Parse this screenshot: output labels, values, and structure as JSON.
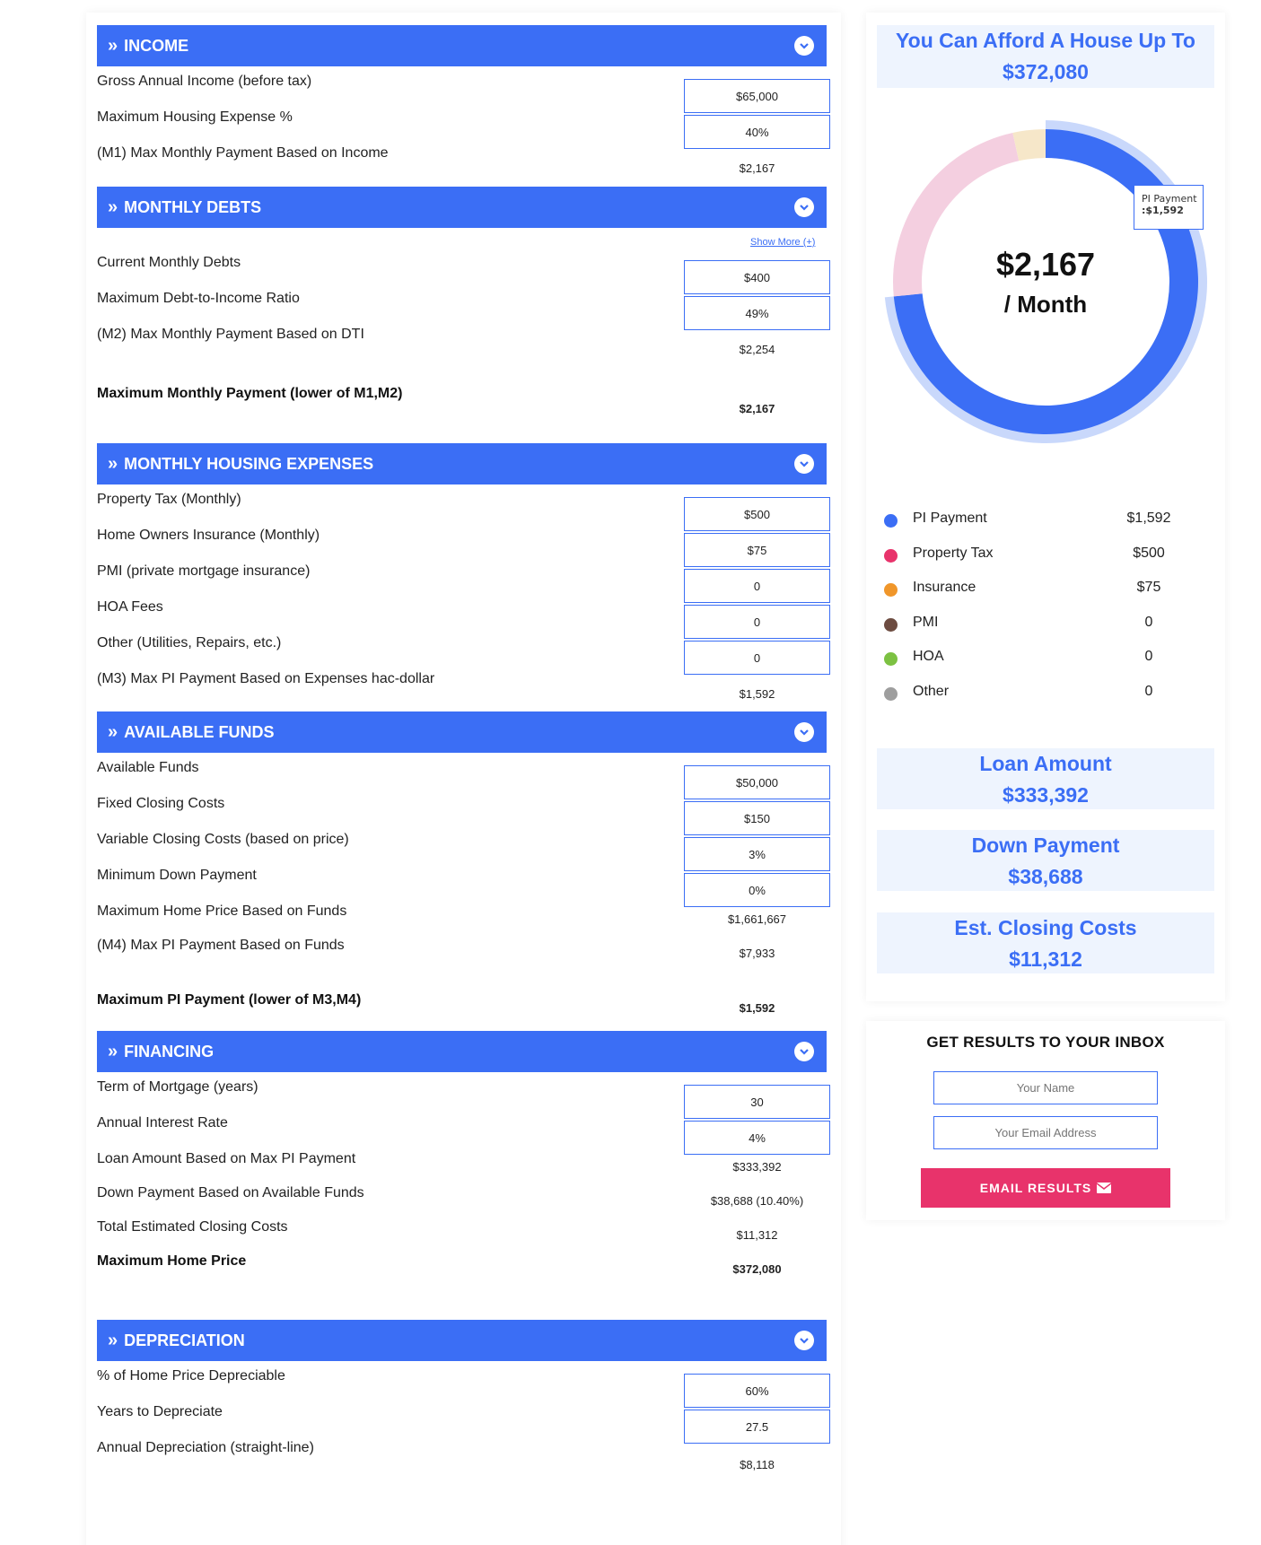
{
  "sections": [
    {
      "title": "INCOME",
      "rows": [
        {
          "label": "Gross Annual Income (before tax)",
          "value": "$65,000",
          "kind": "input"
        },
        {
          "label": "Maximum Housing Expense %",
          "value": "40%",
          "kind": "input"
        },
        {
          "label": "(M1) Max Monthly Payment Based on Income",
          "value": "$2,167",
          "kind": "output"
        }
      ]
    },
    {
      "title": "MONTHLY DEBTS",
      "show_more": "Show More (+)",
      "rows": [
        {
          "label": "Current Monthly Debts",
          "value": "$400",
          "kind": "input"
        },
        {
          "label": "Maximum Debt-to-Income Ratio",
          "value": "49%",
          "kind": "input"
        },
        {
          "label": "(M2) Max Monthly Payment Based on DTI",
          "value": "$2,254",
          "kind": "output"
        },
        {
          "label": "Maximum Monthly Payment (lower of M1,M2)",
          "value": "$2,167",
          "kind": "total"
        }
      ]
    },
    {
      "title": "MONTHLY HOUSING EXPENSES",
      "rows": [
        {
          "label": "Property Tax (Monthly)",
          "value": "$500",
          "kind": "input"
        },
        {
          "label": "Home Owners Insurance (Monthly)",
          "value": "$75",
          "kind": "input"
        },
        {
          "label": "PMI (private mortgage insurance)",
          "value": "0",
          "kind": "input"
        },
        {
          "label": "HOA Fees",
          "value": "0",
          "kind": "input"
        },
        {
          "label": "Other (Utilities, Repairs, etc.)",
          "value": "0",
          "kind": "input"
        },
        {
          "label": "(M3) Max PI Payment Based on Expenses hac-dollar",
          "value": "$1,592",
          "kind": "output"
        }
      ]
    },
    {
      "title": "AVAILABLE FUNDS",
      "rows": [
        {
          "label": "Available Funds",
          "value": "$50,000",
          "kind": "input"
        },
        {
          "label": "Fixed Closing Costs",
          "value": "$150",
          "kind": "input"
        },
        {
          "label": "Variable Closing Costs (based on price)",
          "value": "3%",
          "kind": "input"
        },
        {
          "label": "Minimum Down Payment",
          "value": "0%",
          "kind": "input"
        },
        {
          "label": "Maximum Home Price Based on Funds",
          "value": "$1,661,667",
          "kind": "output"
        },
        {
          "label": "(M4) Max PI Payment Based on Funds",
          "value": "$7,933",
          "kind": "output"
        },
        {
          "label": "Maximum PI Payment (lower of M3,M4)",
          "value": "$1,592",
          "kind": "total"
        }
      ]
    },
    {
      "title": "FINANCING",
      "rows": [
        {
          "label": "Term of Mortgage (years)",
          "value": "30",
          "kind": "input"
        },
        {
          "label": "Annual Interest Rate",
          "value": "4%",
          "kind": "input"
        },
        {
          "label": "Loan Amount Based on Max PI Payment",
          "value": "$333,392",
          "kind": "output"
        },
        {
          "label": "Down Payment Based on Available Funds",
          "value": "$38,688 (10.40%)",
          "kind": "output"
        },
        {
          "label": "Total Estimated Closing Costs",
          "value": "$11,312",
          "kind": "output"
        },
        {
          "label": "Maximum Home Price",
          "value": "$372,080",
          "kind": "total"
        }
      ]
    },
    {
      "title": "DEPRECIATION",
      "rows": [
        {
          "label": "% of Home Price Depreciable",
          "value": "60%",
          "kind": "input"
        },
        {
          "label": "Years to Depreciate",
          "value": "27.5",
          "kind": "input"
        },
        {
          "label": "Annual Depreciation (straight-line)",
          "value": "$8,118",
          "kind": "output"
        }
      ]
    }
  ],
  "summary": {
    "afford_title": "You Can Afford A House Up To",
    "afford_value": "$372,080",
    "donut_amount": "$2,167",
    "donut_period": "/ Month",
    "tooltip_label": "PI Payment",
    "tooltip_value": ":$1,592",
    "loan_title": "Loan Amount",
    "loan_value": "$333,392",
    "down_title": "Down Payment",
    "down_value": "$38,688",
    "closing_title": "Est. Closing Costs",
    "closing_value": "$11,312"
  },
  "chart_data": {
    "type": "pie",
    "categories": [
      "PI Payment",
      "Property Tax",
      "Insurance",
      "PMI",
      "HOA",
      "Other"
    ],
    "values": [
      1592,
      500,
      75,
      0,
      0,
      0
    ],
    "colors": [
      "#3b6ef5",
      "#f4cfe0",
      "#f6e7c9",
      "#6d4c41",
      "#8bc34a",
      "#9e9e9e"
    ],
    "highlighted": "PI Payment"
  },
  "legend": [
    {
      "name": "PI Payment",
      "value": "$1,592",
      "color": "#3b6ef5"
    },
    {
      "name": "Property Tax",
      "value": "$500",
      "color": "#e8336b"
    },
    {
      "name": "Insurance",
      "value": "$75",
      "color": "#f0962a"
    },
    {
      "name": "PMI",
      "value": "0",
      "color": "#6d4c41"
    },
    {
      "name": "HOA",
      "value": "0",
      "color": "#7cc142"
    },
    {
      "name": "Other",
      "value": "0",
      "color": "#9e9e9e"
    }
  ],
  "email": {
    "title": "GET RESULTS TO YOUR INBOX",
    "name_placeholder": "Your Name",
    "email_placeholder": "Your Email Address",
    "button_label": "EMAIL RESULTS"
  },
  "colors": {
    "accent": "#3b6ef5",
    "button": "#e8336b",
    "stat_bg": "#eef4fe"
  }
}
